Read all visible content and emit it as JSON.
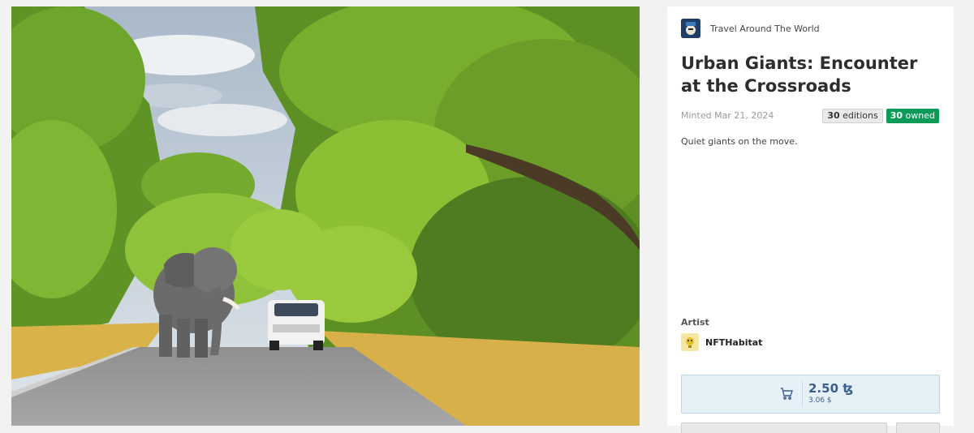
{
  "artwork": {
    "alt": "Elephant walking on a road among green trees with a white car behind"
  },
  "collection": {
    "name": "Travel Around The World",
    "avatar_icon": "collection-avatar"
  },
  "token": {
    "title": "Urban Giants: Encounter at the Crossroads",
    "minted": "Minted Mar 21, 2024",
    "editions_count": "30",
    "editions_label": "editions",
    "owned_count": "30",
    "owned_label": "owned",
    "description": "Quiet giants on the move."
  },
  "artist": {
    "label": "Artist",
    "name": "NFTHabitat",
    "avatar_icon": "habitat-avatar"
  },
  "purchase": {
    "price": "2.50 ꜩ",
    "fiat": "3.06 $",
    "icon": "cart-icon"
  },
  "colors": {
    "owned_badge": "#0b9a57",
    "buy_bg": "#e6f1f7",
    "price_text": "#3b5f8a"
  }
}
